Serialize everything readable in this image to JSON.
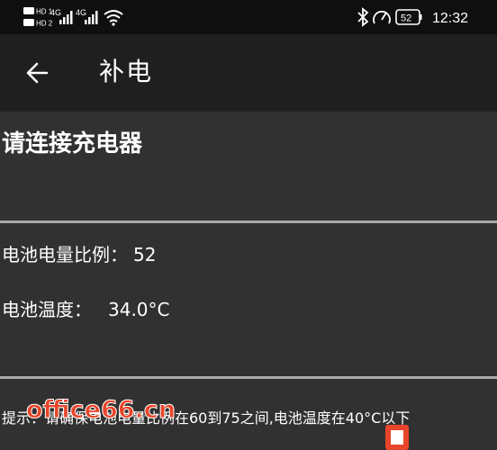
{
  "status_bar": {
    "sim1_label": "HD 1",
    "sim2_label": "HD 2",
    "network1": "4G",
    "network2": "4G",
    "battery_level": "52",
    "time": "12:32",
    "icons": [
      "hd-icon",
      "signal-icon",
      "wifi-icon",
      "bluetooth-icon",
      "speed-gauge-icon",
      "battery-icon"
    ]
  },
  "app_bar": {
    "title": "补电",
    "back_icon": "arrow-left-icon"
  },
  "main": {
    "prompt": "请连接充电器",
    "battery_ratio_label": "电池电量比例：",
    "battery_ratio_value": "52",
    "battery_temp_label": "电池温度：",
    "battery_temp_value": "34.0°C",
    "hint": "提示：请确保电池电量比例在60到75之间,电池温度在40°C以下"
  },
  "watermark": {
    "text": "office66.cn",
    "logo_icon": "office-logo-icon"
  },
  "colors": {
    "background": "#313131",
    "app_bar": "#1f1f1f",
    "status_bar": "#0f0f0f",
    "divider": "#a9a9a9",
    "text": "#ffffff",
    "watermark": "#e8452a"
  }
}
